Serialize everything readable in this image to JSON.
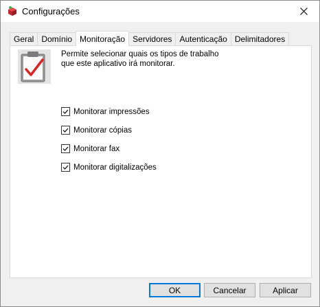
{
  "window": {
    "title": "Configurações",
    "app_icon": "red-box-icon",
    "close_icon": "close-icon"
  },
  "tabs": [
    {
      "label": "Geral",
      "active": false
    },
    {
      "label": "Domínio",
      "active": false
    },
    {
      "label": "Monitoração",
      "active": true
    },
    {
      "label": "Servidores",
      "active": false
    },
    {
      "label": "Autenticação",
      "active": false
    },
    {
      "label": "Delimitadores",
      "active": false
    }
  ],
  "panel": {
    "icon": "clipboard-check-icon",
    "description_line1": "Permite selecionar quais os tipos de trabalho",
    "description_line2": "que este aplicativo irá monitorar.",
    "options": [
      {
        "label": "Monitorar impressões",
        "checked": true
      },
      {
        "label": "Monitorar cópias",
        "checked": true
      },
      {
        "label": "Monitorar fax",
        "checked": true
      },
      {
        "label": "Monitorar digitalizações",
        "checked": true
      }
    ]
  },
  "buttons": {
    "ok": "OK",
    "cancel": "Cancelar",
    "apply": "Aplicar"
  },
  "colors": {
    "accent": "#0078d7",
    "check_mark": "#dd2222"
  }
}
